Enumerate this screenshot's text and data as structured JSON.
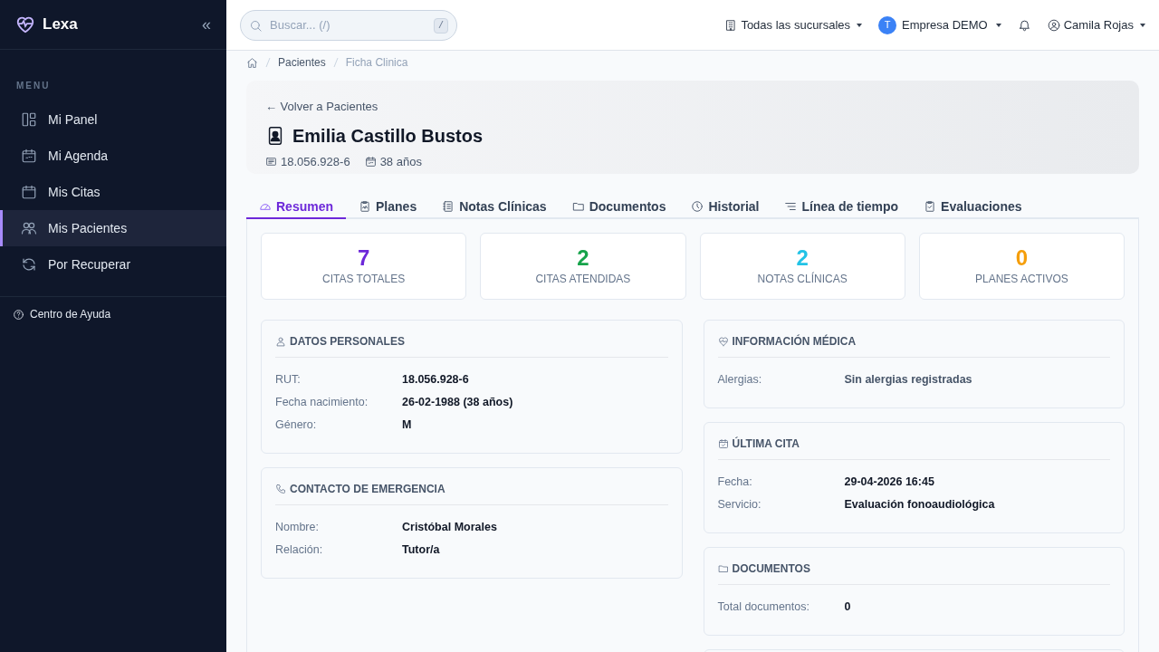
{
  "sidebar": {
    "brand": "Lexa",
    "collapse": "«",
    "section": "MENU",
    "items": [
      {
        "label": "Mi Panel",
        "selected": false
      },
      {
        "label": "Mi Agenda",
        "selected": false
      },
      {
        "label": "Mis Citas",
        "selected": false
      },
      {
        "label": "Mis Pacientes",
        "selected": true
      },
      {
        "label": "Por Recuperar",
        "selected": false
      }
    ],
    "help": "Centro de Ayuda"
  },
  "topbar": {
    "search": {
      "placeholder": "Buscar... (/)",
      "shortcut": "/"
    },
    "branch": "Todas las sucursales",
    "company_initial": "T",
    "company": "Empresa DEMO",
    "user": "Camila Rojas"
  },
  "breadcrumb": [
    "Pacientes",
    "Ficha Clinica"
  ],
  "patient": {
    "back": "← Volver a Pacientes",
    "name": "Emilia Castillo Bustos",
    "rut": "18.056.928-6",
    "age": "38 años"
  },
  "tabs": [
    {
      "label": "Resumen",
      "selected": true
    },
    {
      "label": "Planes",
      "selected": false
    },
    {
      "label": "Notas Clínicas",
      "selected": false
    },
    {
      "label": "Documentos",
      "selected": false
    },
    {
      "label": "Historial",
      "selected": false
    },
    {
      "label": "Línea de tiempo",
      "selected": false
    },
    {
      "label": "Evaluaciones",
      "selected": false
    }
  ],
  "stats": [
    {
      "value": "7",
      "label": "CITAS TOTALES",
      "color": "#6d28d9"
    },
    {
      "value": "2",
      "label": "CITAS ATENDIDAS",
      "color": "#16a34a"
    },
    {
      "value": "2",
      "label": "NOTAS CLÍNICAS",
      "color": "#22c3e6"
    },
    {
      "value": "0",
      "label": "PLANES ACTIVOS",
      "color": "#f59e0b"
    }
  ],
  "left_cards": [
    {
      "title": "DATOS PERSONALES",
      "rows": [
        {
          "label": "RUT:",
          "value": "18.056.928-6",
          "muted": false
        },
        {
          "label": "Fecha nacimiento:",
          "value": "26-02-1988 (38 años)",
          "muted": false
        },
        {
          "label": "Género:",
          "value": "M",
          "muted": false
        }
      ]
    },
    {
      "title": "CONTACTO DE EMERGENCIA",
      "rows": [
        {
          "label": "Nombre:",
          "value": "Cristóbal Morales",
          "muted": false
        },
        {
          "label": "Relación:",
          "value": "Tutor/a",
          "muted": false
        }
      ]
    }
  ],
  "right_cards": [
    {
      "title": "INFORMACIÓN MÉDICA",
      "rows": [
        {
          "label": "Alergias:",
          "value": "Sin alergias registradas",
          "muted": true
        }
      ]
    },
    {
      "title": "ÚLTIMA CITA",
      "rows": [
        {
          "label": "Fecha:",
          "value": "29-04-2026 16:45",
          "muted": false
        },
        {
          "label": "Servicio:",
          "value": "Evaluación fonoaudiológica",
          "muted": false
        }
      ]
    },
    {
      "title": "DOCUMENTOS",
      "rows": [
        {
          "label": "Total documentos:",
          "value": "0",
          "muted": false
        }
      ]
    }
  ]
}
